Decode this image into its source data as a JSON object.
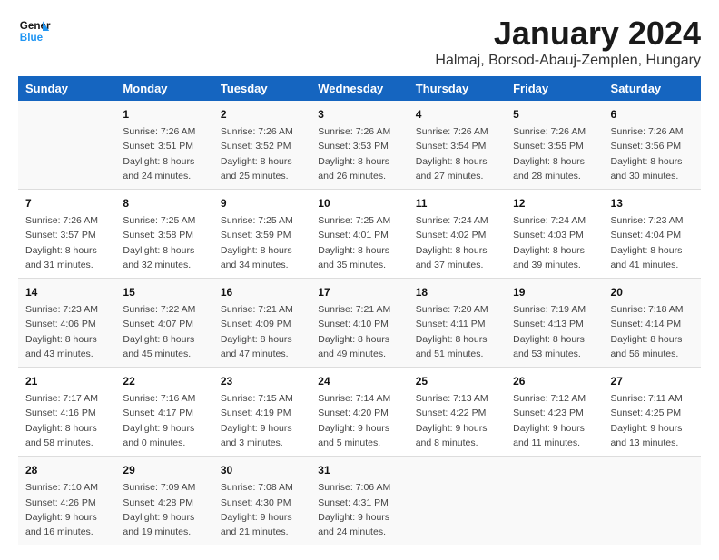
{
  "logo": {
    "text_general": "General",
    "text_blue": "Blue"
  },
  "title": "January 2024",
  "subtitle": "Halmaj, Borsod-Abauj-Zemplen, Hungary",
  "columns": [
    "Sunday",
    "Monday",
    "Tuesday",
    "Wednesday",
    "Thursday",
    "Friday",
    "Saturday"
  ],
  "weeks": [
    [
      {
        "day": "",
        "content": ""
      },
      {
        "day": "1",
        "content": "Sunrise: 7:26 AM\nSunset: 3:51 PM\nDaylight: 8 hours\nand 24 minutes."
      },
      {
        "day": "2",
        "content": "Sunrise: 7:26 AM\nSunset: 3:52 PM\nDaylight: 8 hours\nand 25 minutes."
      },
      {
        "day": "3",
        "content": "Sunrise: 7:26 AM\nSunset: 3:53 PM\nDaylight: 8 hours\nand 26 minutes."
      },
      {
        "day": "4",
        "content": "Sunrise: 7:26 AM\nSunset: 3:54 PM\nDaylight: 8 hours\nand 27 minutes."
      },
      {
        "day": "5",
        "content": "Sunrise: 7:26 AM\nSunset: 3:55 PM\nDaylight: 8 hours\nand 28 minutes."
      },
      {
        "day": "6",
        "content": "Sunrise: 7:26 AM\nSunset: 3:56 PM\nDaylight: 8 hours\nand 30 minutes."
      }
    ],
    [
      {
        "day": "7",
        "content": "Sunrise: 7:26 AM\nSunset: 3:57 PM\nDaylight: 8 hours\nand 31 minutes."
      },
      {
        "day": "8",
        "content": "Sunrise: 7:25 AM\nSunset: 3:58 PM\nDaylight: 8 hours\nand 32 minutes."
      },
      {
        "day": "9",
        "content": "Sunrise: 7:25 AM\nSunset: 3:59 PM\nDaylight: 8 hours\nand 34 minutes."
      },
      {
        "day": "10",
        "content": "Sunrise: 7:25 AM\nSunset: 4:01 PM\nDaylight: 8 hours\nand 35 minutes."
      },
      {
        "day": "11",
        "content": "Sunrise: 7:24 AM\nSunset: 4:02 PM\nDaylight: 8 hours\nand 37 minutes."
      },
      {
        "day": "12",
        "content": "Sunrise: 7:24 AM\nSunset: 4:03 PM\nDaylight: 8 hours\nand 39 minutes."
      },
      {
        "day": "13",
        "content": "Sunrise: 7:23 AM\nSunset: 4:04 PM\nDaylight: 8 hours\nand 41 minutes."
      }
    ],
    [
      {
        "day": "14",
        "content": "Sunrise: 7:23 AM\nSunset: 4:06 PM\nDaylight: 8 hours\nand 43 minutes."
      },
      {
        "day": "15",
        "content": "Sunrise: 7:22 AM\nSunset: 4:07 PM\nDaylight: 8 hours\nand 45 minutes."
      },
      {
        "day": "16",
        "content": "Sunrise: 7:21 AM\nSunset: 4:09 PM\nDaylight: 8 hours\nand 47 minutes."
      },
      {
        "day": "17",
        "content": "Sunrise: 7:21 AM\nSunset: 4:10 PM\nDaylight: 8 hours\nand 49 minutes."
      },
      {
        "day": "18",
        "content": "Sunrise: 7:20 AM\nSunset: 4:11 PM\nDaylight: 8 hours\nand 51 minutes."
      },
      {
        "day": "19",
        "content": "Sunrise: 7:19 AM\nSunset: 4:13 PM\nDaylight: 8 hours\nand 53 minutes."
      },
      {
        "day": "20",
        "content": "Sunrise: 7:18 AM\nSunset: 4:14 PM\nDaylight: 8 hours\nand 56 minutes."
      }
    ],
    [
      {
        "day": "21",
        "content": "Sunrise: 7:17 AM\nSunset: 4:16 PM\nDaylight: 8 hours\nand 58 minutes."
      },
      {
        "day": "22",
        "content": "Sunrise: 7:16 AM\nSunset: 4:17 PM\nDaylight: 9 hours\nand 0 minutes."
      },
      {
        "day": "23",
        "content": "Sunrise: 7:15 AM\nSunset: 4:19 PM\nDaylight: 9 hours\nand 3 minutes."
      },
      {
        "day": "24",
        "content": "Sunrise: 7:14 AM\nSunset: 4:20 PM\nDaylight: 9 hours\nand 5 minutes."
      },
      {
        "day": "25",
        "content": "Sunrise: 7:13 AM\nSunset: 4:22 PM\nDaylight: 9 hours\nand 8 minutes."
      },
      {
        "day": "26",
        "content": "Sunrise: 7:12 AM\nSunset: 4:23 PM\nDaylight: 9 hours\nand 11 minutes."
      },
      {
        "day": "27",
        "content": "Sunrise: 7:11 AM\nSunset: 4:25 PM\nDaylight: 9 hours\nand 13 minutes."
      }
    ],
    [
      {
        "day": "28",
        "content": "Sunrise: 7:10 AM\nSunset: 4:26 PM\nDaylight: 9 hours\nand 16 minutes."
      },
      {
        "day": "29",
        "content": "Sunrise: 7:09 AM\nSunset: 4:28 PM\nDaylight: 9 hours\nand 19 minutes."
      },
      {
        "day": "30",
        "content": "Sunrise: 7:08 AM\nSunset: 4:30 PM\nDaylight: 9 hours\nand 21 minutes."
      },
      {
        "day": "31",
        "content": "Sunrise: 7:06 AM\nSunset: 4:31 PM\nDaylight: 9 hours\nand 24 minutes."
      },
      {
        "day": "",
        "content": ""
      },
      {
        "day": "",
        "content": ""
      },
      {
        "day": "",
        "content": ""
      }
    ]
  ]
}
